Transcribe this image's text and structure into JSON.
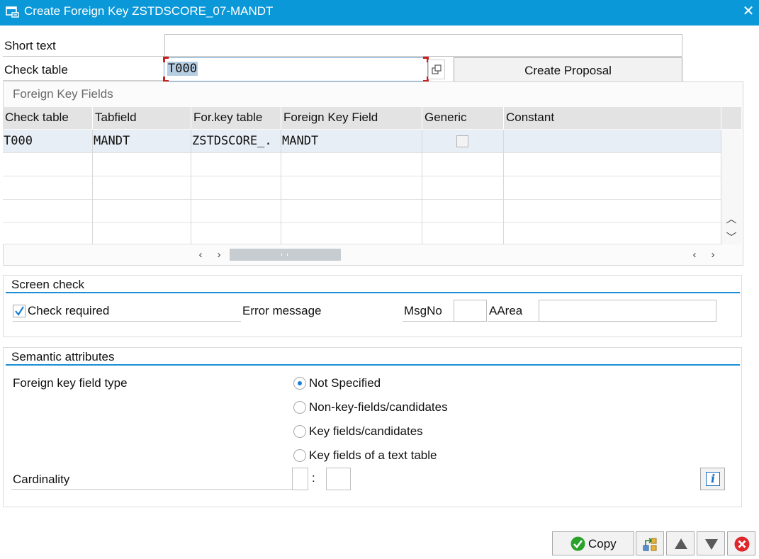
{
  "window": {
    "title": "Create Foreign Key ZSTDSCORE_07-MANDT"
  },
  "header_fields": {
    "short_text_label": "Short text",
    "short_text_value": "",
    "check_table_label": "Check table",
    "check_table_value": "T000",
    "create_proposal_label": "Create Proposal"
  },
  "fk_fields": {
    "group_title": "Foreign Key Fields",
    "columns": [
      "Check table",
      "Tabfield",
      "For.key table",
      "Foreign Key Field",
      "Generic",
      "Constant"
    ],
    "rows": [
      {
        "check_table": "T000",
        "tabfield": "MANDT",
        "for_key_table": "ZSTDSCORE_",
        "foreign_key_field": "MANDT",
        "generic": false,
        "constant": ""
      }
    ],
    "ellipsis": "."
  },
  "screen_check": {
    "title": "Screen check",
    "check_required_label": "Check required",
    "check_required": true,
    "error_message_label": "Error message",
    "msgno_label": "MsgNo",
    "msgno_value": "",
    "aarea_label": "AArea",
    "aarea_value": ""
  },
  "semantic": {
    "title": "Semantic attributes",
    "field_type_label": "Foreign key field type",
    "options": [
      {
        "label": "Not Specified",
        "selected": true
      },
      {
        "label": "Non-key-fields/candidates",
        "selected": false
      },
      {
        "label": "Key fields/candidates",
        "selected": false
      },
      {
        "label": "Key fields of a text table",
        "selected": false
      }
    ],
    "cardinality_label": "Cardinality",
    "cardinality_left": "",
    "cardinality_sep": ":",
    "cardinality_right": "",
    "info_icon_glyph": "i"
  },
  "footer": {
    "copy_label": "Copy"
  },
  "icons": {
    "window": "dialog-icon",
    "close": "close-icon",
    "value_help": "value-help-icon",
    "copy": "check-icon",
    "hierarchy": "hierarchy-icon",
    "up": "arrow-up-icon",
    "down": "arrow-down-icon",
    "cancel": "cancel-icon"
  },
  "colors": {
    "titlebar": "#0a98d8",
    "accent": "#1a8fd6",
    "focus": "#cc1f1f",
    "cancel": "#e0262b",
    "ok": "#2aa12a"
  }
}
